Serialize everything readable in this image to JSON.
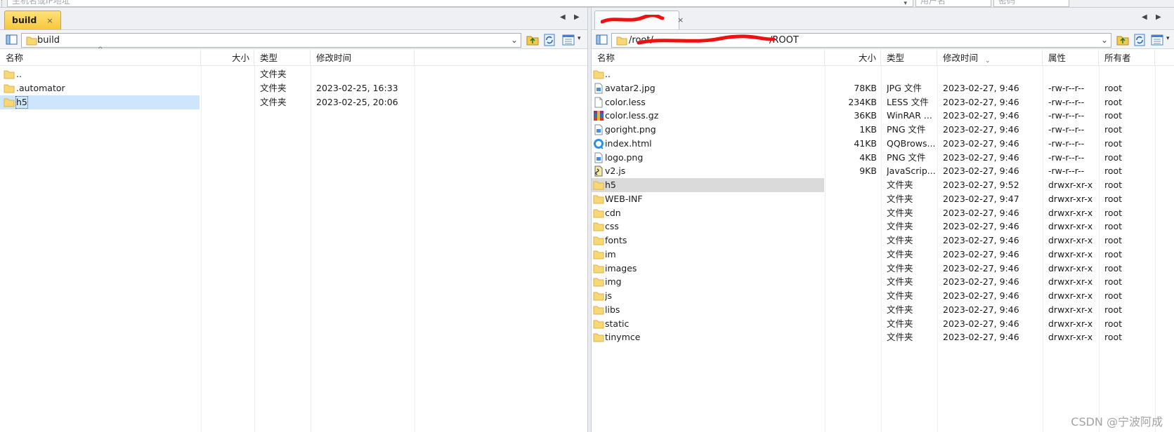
{
  "topbar": {
    "host_placeholder": "主机名或IP地址",
    "user_placeholder": "用户名",
    "pass_placeholder": "密码"
  },
  "left": {
    "tab_label": "build",
    "tab_close": "×",
    "nav_prev": "◀",
    "nav_next": "▶",
    "path": "build",
    "headers": {
      "name": "名称",
      "size": "大小",
      "type": "类型",
      "mtime": "修改时间"
    },
    "rows": [
      {
        "name": "..",
        "icon": "folder-icon",
        "size": "",
        "type": "文件夹",
        "mtime": ""
      },
      {
        "name": ".automator",
        "icon": "folder-icon",
        "size": "",
        "type": "文件夹",
        "mtime": "2023-02-25, 16:33"
      },
      {
        "name": "h5",
        "icon": "folder-icon",
        "size": "",
        "type": "文件夹",
        "mtime": "2023-02-25, 20:06"
      }
    ]
  },
  "right": {
    "tab_close": "×",
    "nav_prev": "◀",
    "nav_next": "▶",
    "path_prefix": "/root/",
    "path_suffix": "/ROOT",
    "headers": {
      "name": "名称",
      "size": "大小",
      "type": "类型",
      "mtime": "修改时间",
      "perm": "属性",
      "owner": "所有者"
    },
    "rows": [
      {
        "name": "..",
        "icon": "folder-icon",
        "size": "",
        "type": "",
        "mtime": "",
        "perm": "",
        "owner": ""
      },
      {
        "name": "avatar2.jpg",
        "icon": "image-file-icon",
        "size": "78KB",
        "type": "JPG 文件",
        "mtime": "2023-02-27, 9:46",
        "perm": "-rw-r--r--",
        "owner": "root"
      },
      {
        "name": "color.less",
        "icon": "blank-file-icon",
        "size": "234KB",
        "type": "LESS 文件",
        "mtime": "2023-02-27, 9:46",
        "perm": "-rw-r--r--",
        "owner": "root"
      },
      {
        "name": "color.less.gz",
        "icon": "winrar-archive-icon",
        "size": "36KB",
        "type": "WinRAR ...",
        "mtime": "2023-02-27, 9:46",
        "perm": "-rw-r--r--",
        "owner": "root"
      },
      {
        "name": "goright.png",
        "icon": "image-file-icon",
        "size": "1KB",
        "type": "PNG 文件",
        "mtime": "2023-02-27, 9:46",
        "perm": "-rw-r--r--",
        "owner": "root"
      },
      {
        "name": "index.html",
        "icon": "qqbrowser-html-icon",
        "size": "41KB",
        "type": "QQBrows...",
        "mtime": "2023-02-27, 9:46",
        "perm": "-rw-r--r--",
        "owner": "root"
      },
      {
        "name": "logo.png",
        "icon": "image-file-icon",
        "size": "4KB",
        "type": "PNG 文件",
        "mtime": "2023-02-27, 9:46",
        "perm": "-rw-r--r--",
        "owner": "root"
      },
      {
        "name": "v2.js",
        "icon": "javascript-file-icon",
        "size": "9KB",
        "type": "JavaScrip...",
        "mtime": "2023-02-27, 9:46",
        "perm": "-rw-r--r--",
        "owner": "root"
      },
      {
        "name": "h5",
        "icon": "folder-icon",
        "size": "",
        "type": "文件夹",
        "mtime": "2023-02-27, 9:52",
        "perm": "drwxr-xr-x",
        "owner": "root"
      },
      {
        "name": "WEB-INF",
        "icon": "folder-icon",
        "size": "",
        "type": "文件夹",
        "mtime": "2023-02-27, 9:47",
        "perm": "drwxr-xr-x",
        "owner": "root"
      },
      {
        "name": "cdn",
        "icon": "folder-icon",
        "size": "",
        "type": "文件夹",
        "mtime": "2023-02-27, 9:46",
        "perm": "drwxr-xr-x",
        "owner": "root"
      },
      {
        "name": "css",
        "icon": "folder-icon",
        "size": "",
        "type": "文件夹",
        "mtime": "2023-02-27, 9:46",
        "perm": "drwxr-xr-x",
        "owner": "root"
      },
      {
        "name": "fonts",
        "icon": "folder-icon",
        "size": "",
        "type": "文件夹",
        "mtime": "2023-02-27, 9:46",
        "perm": "drwxr-xr-x",
        "owner": "root"
      },
      {
        "name": "im",
        "icon": "folder-icon",
        "size": "",
        "type": "文件夹",
        "mtime": "2023-02-27, 9:46",
        "perm": "drwxr-xr-x",
        "owner": "root"
      },
      {
        "name": "images",
        "icon": "folder-icon",
        "size": "",
        "type": "文件夹",
        "mtime": "2023-02-27, 9:46",
        "perm": "drwxr-xr-x",
        "owner": "root"
      },
      {
        "name": "img",
        "icon": "folder-icon",
        "size": "",
        "type": "文件夹",
        "mtime": "2023-02-27, 9:46",
        "perm": "drwxr-xr-x",
        "owner": "root"
      },
      {
        "name": "js",
        "icon": "folder-icon",
        "size": "",
        "type": "文件夹",
        "mtime": "2023-02-27, 9:46",
        "perm": "drwxr-xr-x",
        "owner": "root"
      },
      {
        "name": "libs",
        "icon": "folder-icon",
        "size": "",
        "type": "文件夹",
        "mtime": "2023-02-27, 9:46",
        "perm": "drwxr-xr-x",
        "owner": "root"
      },
      {
        "name": "static",
        "icon": "folder-icon",
        "size": "",
        "type": "文件夹",
        "mtime": "2023-02-27, 9:46",
        "perm": "drwxr-xr-x",
        "owner": "root"
      },
      {
        "name": "tinymce",
        "icon": "folder-icon",
        "size": "",
        "type": "文件夹",
        "mtime": "2023-02-27, 9:46",
        "perm": "drwxr-xr-x",
        "owner": "root"
      }
    ]
  },
  "watermark": "CSDN @宁波阿成",
  "colors": {
    "active_tab": "#f6c73b",
    "selected_row": "#cde6fb",
    "highlight_row": "#dadada",
    "folder": "#f8d775",
    "redaction": "#ee1111"
  }
}
